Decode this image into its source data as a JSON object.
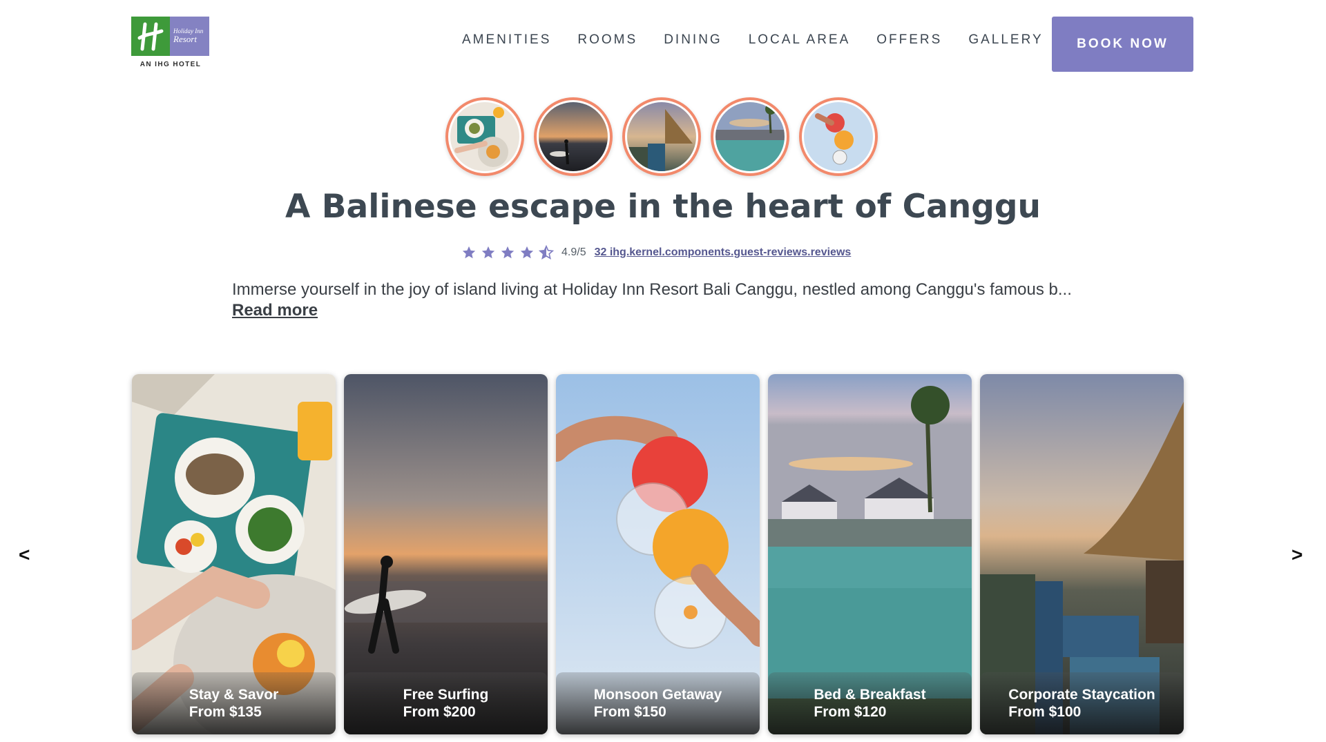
{
  "brand": {
    "logo_line1": "Holiday Inn",
    "logo_line2": "Resort",
    "subtitle": "AN IHG HOTEL"
  },
  "nav": {
    "items": [
      {
        "label": "AMENITIES"
      },
      {
        "label": "ROOMS"
      },
      {
        "label": "DINING"
      },
      {
        "label": "LOCAL AREA"
      },
      {
        "label": "OFFERS"
      },
      {
        "label": "GALLERY"
      }
    ],
    "book_label": "BOOK NOW"
  },
  "thumbnails": [
    {
      "icon": "breakfast-thumbnail"
    },
    {
      "icon": "surfer-sunset-thumbnail"
    },
    {
      "icon": "resort-pool-thumbnail"
    },
    {
      "icon": "infinity-pool-thumbnail"
    },
    {
      "icon": "cocktails-thumbnail"
    }
  ],
  "hero": {
    "title": "A Balinese escape in the heart of Canggu",
    "rating_value": 4.5,
    "rating_score": "4.9/5",
    "reviews_link": "32 ihg.kernel.components.guest-reviews.reviews",
    "intro": "Immerse yourself in the joy of island living at Holiday Inn Resort Bali Canggu, nestled among Canggu's famous b...",
    "read_more": "Read more"
  },
  "carousel": {
    "prev": "<",
    "next": ">",
    "cards": [
      {
        "name": "Stay & Savor",
        "price": "From $135"
      },
      {
        "name": "Free Surfing",
        "price": "From $200"
      },
      {
        "name": "Monsoon Getaway",
        "price": "From $150"
      },
      {
        "name": "Bed & Breakfast",
        "price": "From $120"
      },
      {
        "name": "Corporate Staycation",
        "price": "From $100"
      }
    ]
  },
  "colors": {
    "accent": "#7f7dc2",
    "ring": "#f2896b",
    "brand_green": "#3e9a3a"
  }
}
